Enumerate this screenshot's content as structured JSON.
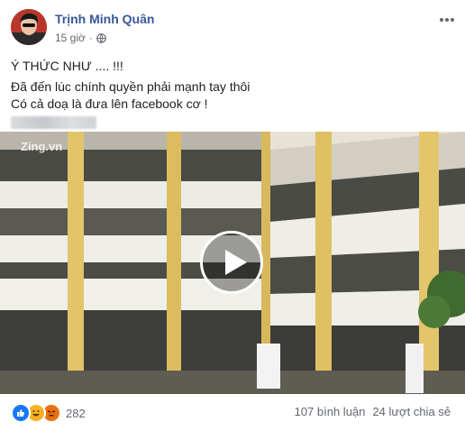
{
  "post": {
    "author": "Trịnh Minh Quân",
    "time": "15 giờ",
    "privacy_icon": "globe-icon",
    "more_icon": "more-horizontal-icon",
    "text_lines": [
      "Ý THỨC NHƯ .... !!!",
      "Đã đến lúc chính quyền phải mạnh tay thôi",
      "Có cả doạ là đưa lên facebook cơ !"
    ]
  },
  "video": {
    "watermark": "Zing.vn",
    "play_icon": "play-icon"
  },
  "footer": {
    "reactions": [
      "like-icon",
      "haha-icon",
      "angry-icon"
    ],
    "reaction_count": "282",
    "comments": "107 bình luận",
    "shares": "24 lượt chia sẻ"
  },
  "colors": {
    "author_link": "#385898",
    "meta_text": "#616770",
    "like_blue": "#1877f2"
  }
}
